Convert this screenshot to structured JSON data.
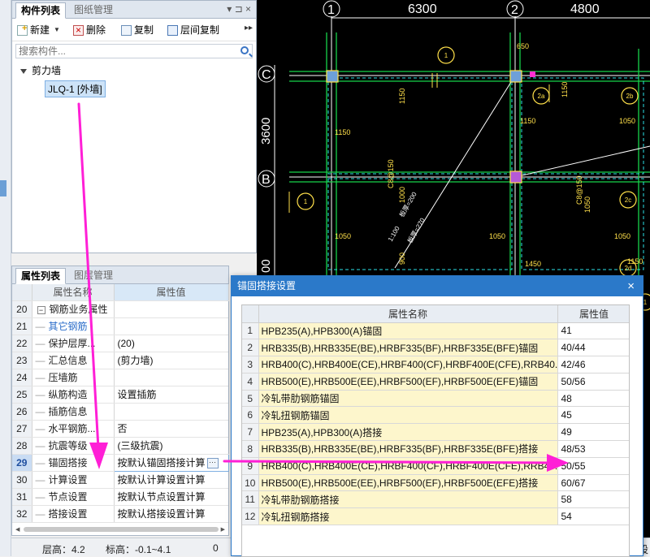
{
  "component_panel": {
    "tabs": [
      "构件列表",
      "图纸管理"
    ],
    "controls": "▾ ⊐ ×",
    "toolbar": {
      "new": "新建",
      "delete": "删除",
      "copy": "复制",
      "floor_copy": "层间复制",
      "more": "▸▸"
    },
    "search_placeholder": "搜索构件...",
    "tree": {
      "root": "剪力墙",
      "child": "JLQ-1 [外墙]"
    }
  },
  "property_panel": {
    "tabs": [
      "属性列表",
      "图层管理"
    ],
    "headers": {
      "name": "属性名称",
      "value": "属性值"
    },
    "rows": [
      {
        "num": "20",
        "name": "钢筋业务属性",
        "value": ""
      },
      {
        "num": "21",
        "name": "其它钢筋",
        "value": ""
      },
      {
        "num": "22",
        "name": "保护层厚...",
        "value": "(20)"
      },
      {
        "num": "23",
        "name": "汇总信息",
        "value": "(剪力墙)"
      },
      {
        "num": "24",
        "name": "压墙筋",
        "value": ""
      },
      {
        "num": "25",
        "name": "纵筋构造",
        "value": "设置插筋"
      },
      {
        "num": "26",
        "name": "插筋信息",
        "value": ""
      },
      {
        "num": "27",
        "name": "水平钢筋...",
        "value": "否"
      },
      {
        "num": "28",
        "name": "抗震等级",
        "value": "(三级抗震)"
      },
      {
        "num": "29",
        "name": "锚固搭接",
        "value": "按默认锚固搭接计算"
      },
      {
        "num": "30",
        "name": "计算设置",
        "value": "按默认计算设置计算"
      },
      {
        "num": "31",
        "name": "节点设置",
        "value": "按默认节点设置计算"
      },
      {
        "num": "32",
        "name": "搭接设置",
        "value": "按默认搭接设置计算"
      }
    ],
    "ellipsis": "···"
  },
  "status_bar": {
    "floor_height": "层高：4.2",
    "elevation": "标高：-0.1~4.1",
    "count": "0",
    "right_text": "设"
  },
  "cad": {
    "dims": [
      "6300",
      "4800"
    ],
    "axes_vertical": [
      "1",
      "2"
    ],
    "axes_horizontal": [
      "C",
      "B"
    ],
    "height_dim": "3600",
    "height_dim2": "00",
    "labels": [
      "650",
      "1150",
      "1150",
      "1150",
      "1150",
      "1050",
      "1050",
      "1000",
      "1050",
      "1050",
      "1050",
      "1450",
      "900",
      "1150"
    ],
    "vertical_labels": [
      "C8@150",
      "C8@150"
    ],
    "diag_labels": [
      "板厚=200",
      "板厚=270",
      "1:100"
    ],
    "circle_labels": [
      "1",
      "2a",
      "2b",
      "1",
      "2c",
      "1",
      "2d",
      "1a",
      "1"
    ]
  },
  "dialog": {
    "title": "锚固搭接设置",
    "close": "×",
    "headers": {
      "name": "属性名称",
      "value": "属性值"
    },
    "rows": [
      {
        "num": "1",
        "name": "HPB235(A),HPB300(A)锚固",
        "value": "41"
      },
      {
        "num": "2",
        "name": "HRB335(B),HRB335E(BE),HRBF335(BF),HRBF335E(BFE)锚固",
        "value": "40/44"
      },
      {
        "num": "3",
        "name": "HRB400(C),HRB400E(CE),HRBF400(CF),HRBF400E(CFE),RRB40...",
        "value": "42/46"
      },
      {
        "num": "4",
        "name": "HRB500(E),HRB500E(EE),HRBF500(EF),HRBF500E(EFE)锚固",
        "value": "50/56"
      },
      {
        "num": "5",
        "name": "冷轧带肋钢筋锚固",
        "value": "48"
      },
      {
        "num": "6",
        "name": "冷轧扭钢筋锚固",
        "value": "45"
      },
      {
        "num": "7",
        "name": "HPB235(A),HPB300(A)搭接",
        "value": "49"
      },
      {
        "num": "8",
        "name": "HRB335(B),HRB335E(BE),HRBF335(BF),HRBF335E(BFE)搭接",
        "value": "48/53"
      },
      {
        "num": "9",
        "name": "HRB400(C),HRB400E(CE),HRBF400(CF),HRBF400E(CFE),RRB40...",
        "value": "50/55"
      },
      {
        "num": "10",
        "name": "HRB500(E),HRB500E(EE),HRBF500(EF),HRBF500E(EFE)搭接",
        "value": "60/67"
      },
      {
        "num": "11",
        "name": "冷轧带肋钢筋搭接",
        "value": "58"
      },
      {
        "num": "12",
        "name": "冷轧扭钢筋搭接",
        "value": "54"
      }
    ]
  },
  "colors": {
    "accent": "#2b79c9",
    "arrow": "#ff1fd6",
    "cad_bg": "#000000",
    "highlight_row": "#fdf6cc"
  }
}
